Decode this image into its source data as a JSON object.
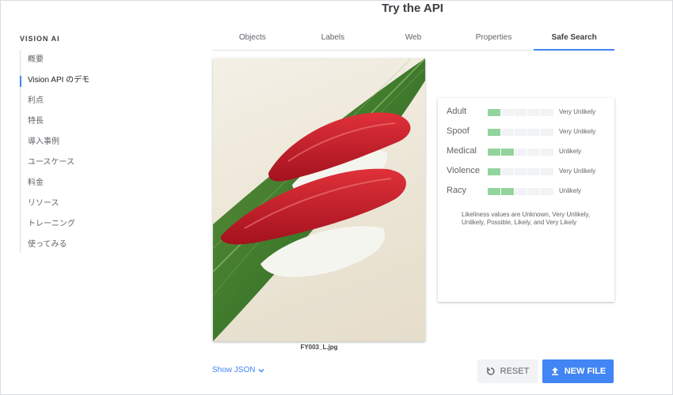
{
  "page": {
    "title": "Try the API"
  },
  "sidebar": {
    "heading": "VISION AI",
    "items": [
      {
        "label": "概要"
      },
      {
        "label": "Vision API のデモ"
      },
      {
        "label": "利点"
      },
      {
        "label": "特長"
      },
      {
        "label": "導入事例"
      },
      {
        "label": "ユースケース"
      },
      {
        "label": "料金"
      },
      {
        "label": "リソース"
      },
      {
        "label": "トレーニング"
      },
      {
        "label": "使ってみる"
      }
    ]
  },
  "tabs": [
    {
      "label": "Objects"
    },
    {
      "label": "Labels"
    },
    {
      "label": "Web"
    },
    {
      "label": "Properties"
    },
    {
      "label": "Safe Search"
    }
  ],
  "image": {
    "caption": "FY003_L.jpg"
  },
  "safe_search": {
    "segments_total": 5,
    "rows": [
      {
        "label": "Adult",
        "level": 1,
        "value": "Very Unlikely"
      },
      {
        "label": "Spoof",
        "level": 1,
        "value": "Very Unlikely"
      },
      {
        "label": "Medical",
        "level": 2,
        "value": "Unlikely"
      },
      {
        "label": "Violence",
        "level": 1,
        "value": "Very Unlikely"
      },
      {
        "label": "Racy",
        "level": 2,
        "value": "Unlikely"
      }
    ],
    "note": "Likeliness values are Unknown, Very Unlikely, Unlikely, Possible, Likely, and Very Likely",
    "bar_color": "#93d49c"
  },
  "controls": {
    "show_json": "Show JSON",
    "reset": "RESET",
    "new_file": "NEW FILE"
  },
  "colors": {
    "accent": "#4285f4"
  }
}
